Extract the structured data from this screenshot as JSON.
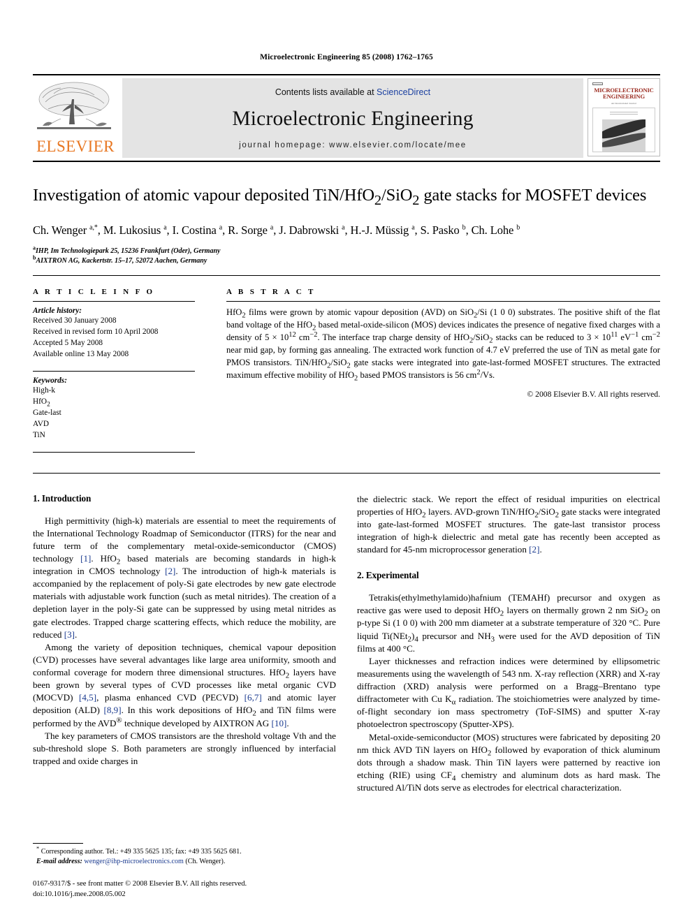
{
  "running_head": "Microelectronic Engineering 85 (2008) 1762–1765",
  "masthead": {
    "contents_prefix": "Contents lists available at ",
    "sciencedirect": "ScienceDirect",
    "journal_title": "Microelectronic Engineering",
    "homepage": "journal homepage: www.elsevier.com/locate/mee",
    "publisher_logo_text": "ELSEVIER",
    "cover_title_line1": "MICROELECTRONIC",
    "cover_title_line2": "ENGINEERING",
    "cover_subtitle": "An International Journal"
  },
  "article": {
    "title_html": "Investigation of atomic vapour deposited TiN/HfO<sub>2</sub>/SiO<sub>2</sub> gate stacks for MOSFET devices",
    "authors_html": "Ch. Wenger <sup>a,*</sup>, M. Lukosius <sup>a</sup>, I. Costina <sup>a</sup>, R. Sorge <sup>a</sup>, J. Dabrowski <sup>a</sup>, H.-J. M&uuml;ssig <sup>a</sup>, S. Pasko <sup>b</sup>, Ch. Lohe <sup>b</sup>",
    "affiliation_a": "IHP, Im Technologiepark 25, 15236 Frankfurt (Oder), Germany",
    "affiliation_b": "AIXTRON AG, Kackertstr. 15–17, 52072 Aachen, Germany"
  },
  "article_info": {
    "heading": "A R T I C L E   I N F O",
    "history_label": "Article history:",
    "history": [
      "Received 30 January 2008",
      "Received in revised form 10 April 2008",
      "Accepted 5 May 2008",
      "Available online 13 May 2008"
    ],
    "keywords_label": "Keywords:",
    "keywords_html": "High-k<br>HfO<sub>2</sub><br>Gate-last<br>AVD<br>TiN"
  },
  "abstract": {
    "heading": "A B S T R A C T",
    "text_html": "HfO<sub>2</sub> films were grown by atomic vapour deposition (AVD) on SiO<sub>2</sub>/Si (1 0 0) substrates. The positive shift of the flat band voltage of the HfO<sub>2</sub> based metal-oxide-silicon (MOS) devices indicates the presence of negative fixed charges with a density of 5 &times; 10<sup>12</sup> cm<sup>&minus;2</sup>. The interface trap charge density of HfO<sub>2</sub>/SiO<sub>2</sub> stacks can be reduced to 3 &times; 10<sup>11</sup> eV<sup>&minus;1</sup> cm<sup>&minus;2</sup> near mid gap, by forming gas annealing. The extracted work function of 4.7 eV preferred the use of TiN as metal gate for PMOS transistors. TiN/HfO<sub>2</sub>/SiO<sub>2</sub> gate stacks were integrated into gate-last-formed MOSFET structures. The extracted maximum effective mobility of HfO<sub>2</sub> based PMOS transistors is 56 cm<sup>2</sup>/Vs.",
    "copyright": "&copy; 2008 Elsevier B.V. All rights reserved."
  },
  "sections": {
    "intro_heading": "1. Introduction",
    "intro_p1_html": "High permittivity (high-k) materials are essential to meet the requirements of the International Technology Roadmap of Semiconductor (ITRS) for the near and future term of the complementary metal-oxide-semiconductor (CMOS) technology <span class=\"ref\">[1]</span>. HfO<sub>2</sub> based materials are becoming standards in high-k integration in CMOS technology <span class=\"ref\">[2]</span>. The introduction of high-k materials is accompanied by the replacement of poly-Si gate electrodes by new gate electrode materials with adjustable work function (such as metal nitrides). The creation of a depletion layer in the poly-Si gate can be suppressed by using metal nitrides as gate electrodes. Trapped charge scattering effects, which reduce the mobility, are reduced <span class=\"ref\">[3]</span>.",
    "intro_p2_html": "Among the variety of deposition techniques, chemical vapour deposition (CVD) processes have several advantages like large area uniformity, smooth and conformal coverage for modern three dimensional structures. HfO<sub>2</sub> layers have been grown by several types of CVD processes like metal organic CVD (MOCVD) <span class=\"ref\">[4,5]</span>, plasma enhanced CVD (PECVD) <span class=\"ref\">[6,7]</span> and atomic layer deposition (ALD) <span class=\"ref\">[8,9]</span>. In this work depositions of HfO<sub>2</sub> and TiN films were performed by the AVD<sup>&reg;</sup> technique developed by AIXTRON AG <span class=\"ref\">[10]</span>.",
    "intro_p3_html": "The key parameters of CMOS transistors are the threshold voltage Vth and the sub-threshold slope S. Both parameters are strongly influenced by interfacial trapped and oxide charges in",
    "intro_p3_cont_html": "the dielectric stack. We report the effect of residual impurities on electrical properties of HfO<sub>2</sub> layers. AVD-grown TiN/HfO<sub>2</sub>/SiO<sub>2</sub> gate stacks were integrated into gate-last-formed MOSFET structures. The gate-last transistor process integration of high-k dielectric and metal gate has recently been accepted as standard for 45-nm microprocessor generation <span class=\"ref\">[2]</span>.",
    "exp_heading": "2. Experimental",
    "exp_p1_html": "Tetrakis(ethylmethylamido)hafnium (TEMAHf) precursor and oxygen as reactive gas were used to deposit HfO<sub>2</sub> layers on thermally grown 2 nm SiO<sub>2</sub> on p-type Si (1 0 0) with 200 mm diameter at a substrate temperature of 320 &deg;C. Pure liquid Ti(NEt<sub>2</sub>)<sub>4</sub> precursor and NH<sub>3</sub> were used for the AVD deposition of TiN films at 400 &deg;C.",
    "exp_p2_html": "Layer thicknesses and refraction indices were determined by ellipsometric measurements using the wavelength of 543 nm. X-ray reflection (XRR) and X-ray diffraction (XRD) analysis were performed on a Bragg&ndash;Brentano type diffractometer with Cu K<sub>&alpha;</sub> radiation. The stoichiometries were analyzed by time-of-flight secondary ion mass spectrometry (ToF-SIMS) and sputter X-ray photoelectron spectroscopy (Sputter-XPS).",
    "exp_p3_html": "Metal-oxide-semiconductor (MOS) structures were fabricated by depositing 20 nm thick AVD TiN layers on HfO<sub>2</sub> followed by evaporation of thick aluminum dots through a shadow mask. Thin TiN layers were patterned by reactive ion etching (RIE) using CF<sub>4</sub> chemistry and aluminum dots as hard mask. The structured Al/TiN dots serve as electrodes for electrical characterization."
  },
  "footer": {
    "corresponding_html": "<sup>*</sup> Corresponding author. Tel.: +49 335 5625 135; fax: +49 335 5625 681.",
    "email_label": "E-mail address:",
    "email": "wenger@ihp-microelectronics.com",
    "email_suffix": "(Ch. Wenger).",
    "imprint_line1": "0167-9317/$ - see front matter &copy; 2008 Elsevier B.V. All rights reserved.",
    "imprint_line2": "doi:10.1016/j.mee.2008.05.002"
  }
}
